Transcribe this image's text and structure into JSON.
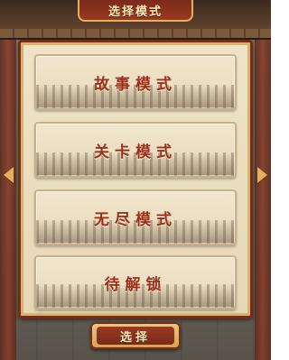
{
  "header": {
    "title": "选择模式"
  },
  "modes": [
    {
      "label": "故事模式"
    },
    {
      "label": "关卡模式"
    },
    {
      "label": "无尽模式"
    },
    {
      "label": "待解锁"
    }
  ],
  "footer": {
    "select_label": "选择"
  },
  "icons": {
    "left": "arrow-left-icon",
    "right": "arrow-right-icon"
  },
  "colors": {
    "accent": "#9b2f1d",
    "gold": "#e0b25a",
    "panel": "#efe3c8"
  }
}
